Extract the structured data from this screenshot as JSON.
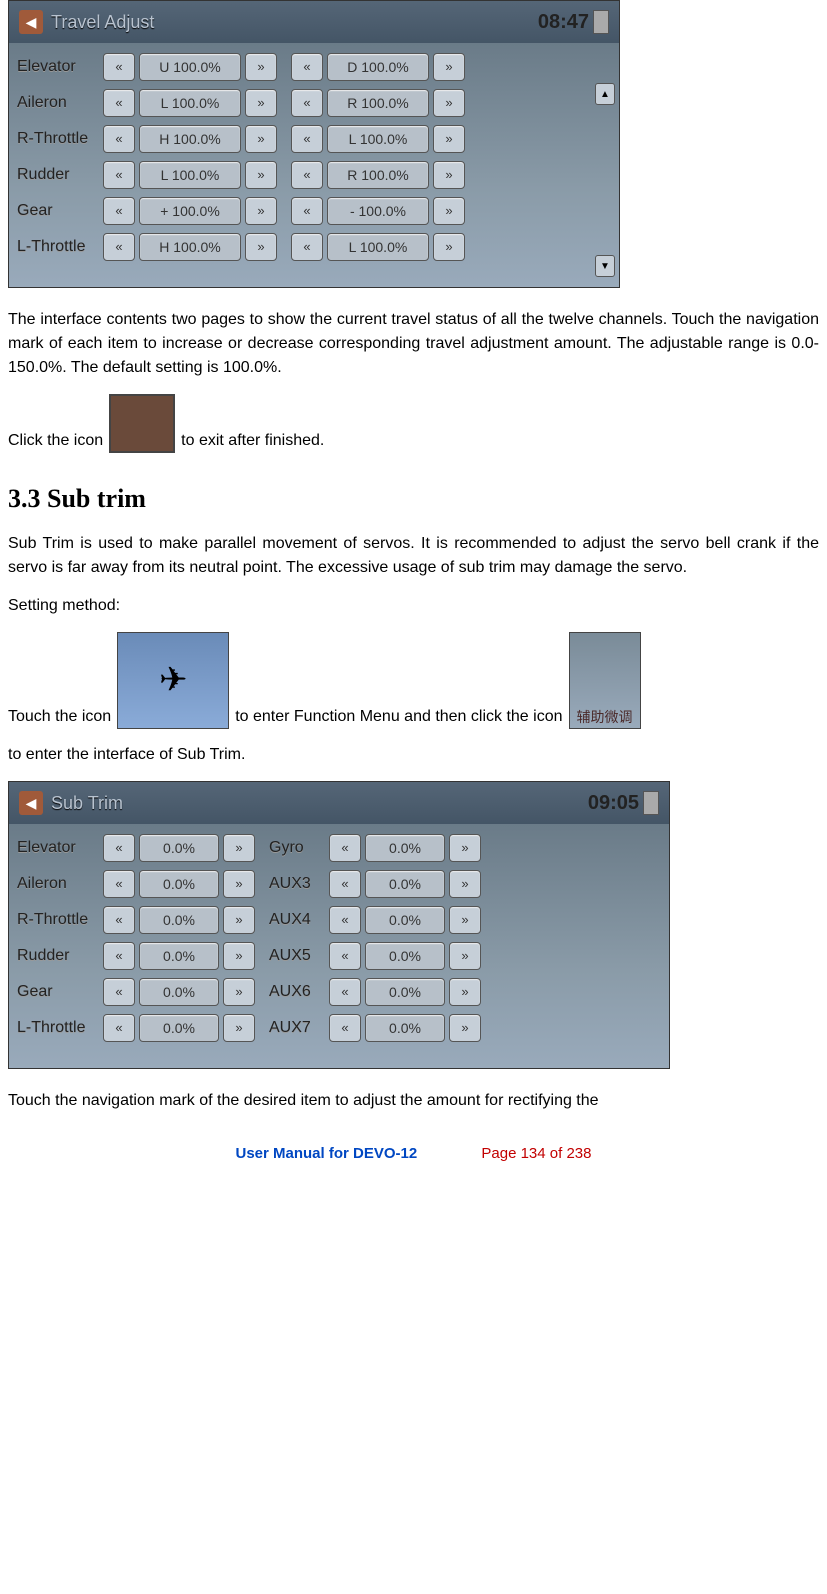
{
  "travel_adjust": {
    "title": "Travel Adjust",
    "clock": "08:47",
    "rows": [
      {
        "label": "Elevator",
        "v1": "U 100.0%",
        "v2": "D 100.0%"
      },
      {
        "label": "Aileron",
        "v1": "L 100.0%",
        "v2": "R 100.0%"
      },
      {
        "label": "R-Throttle",
        "v1": "H 100.0%",
        "v2": "L 100.0%"
      },
      {
        "label": "Rudder",
        "v1": "L 100.0%",
        "v2": "R 100.0%"
      },
      {
        "label": "Gear",
        "v1": "+ 100.0%",
        "v2": "- 100.0%"
      },
      {
        "label": "L-Throttle",
        "v1": "H 100.0%",
        "v2": "L 100.0%"
      }
    ]
  },
  "para1": "The interface contents two pages to show the current travel status of all the twelve channels. Touch the navigation mark of each item to increase or decrease corresponding travel adjustment amount. The adjustable range is 0.0-150.0%. The default setting is 100.0%.",
  "click_icon_pre": "Click the icon",
  "click_icon_post": "to exit after finished.",
  "section_title": "3.3 Sub trim",
  "para2": "Sub Trim is used to make parallel movement of servos. It is recommended to adjust the servo bell crank if the servo is far away from its neutral point. The excessive usage of sub trim may damage the servo.",
  "setting_method": "Setting method:",
  "touch_icon_pre": "Touch the icon",
  "touch_icon_mid": "to enter Function Menu and then click the icon",
  "touch_icon_post": "to enter the interface of Sub Trim.",
  "icon_cn_text": "辅助微调",
  "sub_trim": {
    "title": "Sub Trim",
    "clock": "09:05",
    "rows_left": [
      {
        "label": "Elevator",
        "v": "0.0%"
      },
      {
        "label": "Aileron",
        "v": "0.0%"
      },
      {
        "label": "R-Throttle",
        "v": "0.0%"
      },
      {
        "label": "Rudder",
        "v": "0.0%"
      },
      {
        "label": "Gear",
        "v": "0.0%"
      },
      {
        "label": "L-Throttle",
        "v": "0.0%"
      }
    ],
    "rows_right": [
      {
        "label": "Gyro",
        "v": "0.0%"
      },
      {
        "label": "AUX3",
        "v": "0.0%"
      },
      {
        "label": "AUX4",
        "v": "0.0%"
      },
      {
        "label": "AUX5",
        "v": "0.0%"
      },
      {
        "label": "AUX6",
        "v": "0.0%"
      },
      {
        "label": "AUX7",
        "v": "0.0%"
      }
    ]
  },
  "para3": "Touch the navigation mark of the desired item to adjust the amount for rectifying the",
  "footer_blue": "User Manual for DEVO-12",
  "footer_red": "Page 134 of 238"
}
